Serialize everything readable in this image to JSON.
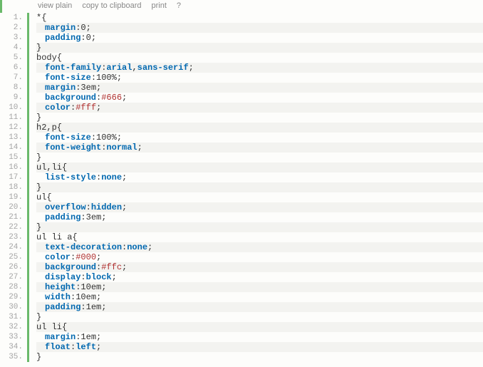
{
  "toolbar": {
    "view_plain": "view plain",
    "copy": "copy to clipboard",
    "print": "print",
    "help": "?"
  },
  "code": {
    "lines": [
      {
        "n": 1,
        "indent": 0,
        "tokens": [
          [
            "selector",
            "*{"
          ]
        ]
      },
      {
        "n": 2,
        "indent": 1,
        "tokens": [
          [
            "property",
            "margin"
          ],
          [
            "punct",
            ":"
          ],
          [
            "num-val",
            "0"
          ],
          [
            "punct",
            ";"
          ]
        ]
      },
      {
        "n": 3,
        "indent": 1,
        "tokens": [
          [
            "property",
            "padding"
          ],
          [
            "punct",
            ":"
          ],
          [
            "num-val",
            "0"
          ],
          [
            "punct",
            ";"
          ]
        ]
      },
      {
        "n": 4,
        "indent": 0,
        "tokens": [
          [
            "selector",
            "}"
          ]
        ]
      },
      {
        "n": 5,
        "indent": 0,
        "tokens": [
          [
            "selector",
            "body{"
          ]
        ]
      },
      {
        "n": 6,
        "indent": 1,
        "tokens": [
          [
            "property",
            "font-family"
          ],
          [
            "punct",
            ":"
          ],
          [
            "keyword",
            "arial"
          ],
          [
            "punct",
            ","
          ],
          [
            "keyword",
            "sans-serif"
          ],
          [
            "punct",
            ";"
          ]
        ]
      },
      {
        "n": 7,
        "indent": 1,
        "tokens": [
          [
            "property",
            "font-size"
          ],
          [
            "punct",
            ":"
          ],
          [
            "num-val",
            "100%"
          ],
          [
            "punct",
            ";"
          ]
        ]
      },
      {
        "n": 8,
        "indent": 1,
        "tokens": [
          [
            "property",
            "margin"
          ],
          [
            "punct",
            ":"
          ],
          [
            "num-val",
            "3em"
          ],
          [
            "punct",
            ";"
          ]
        ]
      },
      {
        "n": 9,
        "indent": 1,
        "tokens": [
          [
            "property",
            "background"
          ],
          [
            "punct",
            ":"
          ],
          [
            "value-hex",
            "#666"
          ],
          [
            "punct",
            ";"
          ]
        ]
      },
      {
        "n": 10,
        "indent": 1,
        "tokens": [
          [
            "property",
            "color"
          ],
          [
            "punct",
            ":"
          ],
          [
            "value-hex",
            "#fff"
          ],
          [
            "punct",
            ";"
          ]
        ]
      },
      {
        "n": 11,
        "indent": 0,
        "tokens": [
          [
            "selector",
            "}"
          ]
        ]
      },
      {
        "n": 12,
        "indent": 0,
        "tokens": [
          [
            "selector",
            "h2,p{"
          ]
        ]
      },
      {
        "n": 13,
        "indent": 1,
        "tokens": [
          [
            "property",
            "font-size"
          ],
          [
            "punct",
            ":"
          ],
          [
            "num-val",
            "100%"
          ],
          [
            "punct",
            ";"
          ]
        ]
      },
      {
        "n": 14,
        "indent": 1,
        "tokens": [
          [
            "property",
            "font-weight"
          ],
          [
            "punct",
            ":"
          ],
          [
            "keyword",
            "normal"
          ],
          [
            "punct",
            ";"
          ]
        ]
      },
      {
        "n": 15,
        "indent": 0,
        "tokens": [
          [
            "selector",
            "}"
          ]
        ]
      },
      {
        "n": 16,
        "indent": 0,
        "tokens": [
          [
            "selector",
            "ul,li{"
          ]
        ]
      },
      {
        "n": 17,
        "indent": 1,
        "tokens": [
          [
            "property",
            "list-style"
          ],
          [
            "punct",
            ":"
          ],
          [
            "keyword",
            "none"
          ],
          [
            "punct",
            ";"
          ]
        ]
      },
      {
        "n": 18,
        "indent": 0,
        "tokens": [
          [
            "selector",
            "}"
          ]
        ]
      },
      {
        "n": 19,
        "indent": 0,
        "tokens": [
          [
            "selector",
            "ul{"
          ]
        ]
      },
      {
        "n": 20,
        "indent": 1,
        "tokens": [
          [
            "property",
            "overflow"
          ],
          [
            "punct",
            ":"
          ],
          [
            "keyword",
            "hidden"
          ],
          [
            "punct",
            ";"
          ]
        ]
      },
      {
        "n": 21,
        "indent": 1,
        "tokens": [
          [
            "property",
            "padding"
          ],
          [
            "punct",
            ":"
          ],
          [
            "num-val",
            "3em"
          ],
          [
            "punct",
            ";"
          ]
        ]
      },
      {
        "n": 22,
        "indent": 0,
        "tokens": [
          [
            "selector",
            "}"
          ]
        ]
      },
      {
        "n": 23,
        "indent": 0,
        "tokens": [
          [
            "selector",
            "ul li a{"
          ]
        ]
      },
      {
        "n": 24,
        "indent": 1,
        "tokens": [
          [
            "property",
            "text-decoration"
          ],
          [
            "punct",
            ":"
          ],
          [
            "keyword",
            "none"
          ],
          [
            "punct",
            ";"
          ]
        ]
      },
      {
        "n": 25,
        "indent": 1,
        "tokens": [
          [
            "property",
            "color"
          ],
          [
            "punct",
            ":"
          ],
          [
            "value-hex",
            "#000"
          ],
          [
            "punct",
            ";"
          ]
        ]
      },
      {
        "n": 26,
        "indent": 1,
        "tokens": [
          [
            "property",
            "background"
          ],
          [
            "punct",
            ":"
          ],
          [
            "value-hex",
            "#ffc"
          ],
          [
            "punct",
            ";"
          ]
        ]
      },
      {
        "n": 27,
        "indent": 1,
        "tokens": [
          [
            "property",
            "display"
          ],
          [
            "punct",
            ":"
          ],
          [
            "keyword",
            "block"
          ],
          [
            "punct",
            ";"
          ]
        ]
      },
      {
        "n": 28,
        "indent": 1,
        "tokens": [
          [
            "property",
            "height"
          ],
          [
            "punct",
            ":"
          ],
          [
            "num-val",
            "10em"
          ],
          [
            "punct",
            ";"
          ]
        ]
      },
      {
        "n": 29,
        "indent": 1,
        "tokens": [
          [
            "property",
            "width"
          ],
          [
            "punct",
            ":"
          ],
          [
            "num-val",
            "10em"
          ],
          [
            "punct",
            ";"
          ]
        ]
      },
      {
        "n": 30,
        "indent": 1,
        "tokens": [
          [
            "property",
            "padding"
          ],
          [
            "punct",
            ":"
          ],
          [
            "num-val",
            "1em"
          ],
          [
            "punct",
            ";"
          ]
        ]
      },
      {
        "n": 31,
        "indent": 0,
        "tokens": [
          [
            "selector",
            "}"
          ]
        ]
      },
      {
        "n": 32,
        "indent": 0,
        "tokens": [
          [
            "selector",
            "ul li{"
          ]
        ]
      },
      {
        "n": 33,
        "indent": 1,
        "tokens": [
          [
            "property",
            "margin"
          ],
          [
            "punct",
            ":"
          ],
          [
            "num-val",
            "1em"
          ],
          [
            "punct",
            ";"
          ]
        ]
      },
      {
        "n": 34,
        "indent": 1,
        "tokens": [
          [
            "property",
            "float"
          ],
          [
            "punct",
            ":"
          ],
          [
            "keyword",
            "left"
          ],
          [
            "punct",
            ";"
          ]
        ]
      },
      {
        "n": 35,
        "indent": 0,
        "tokens": [
          [
            "selector",
            "}"
          ]
        ]
      }
    ]
  }
}
